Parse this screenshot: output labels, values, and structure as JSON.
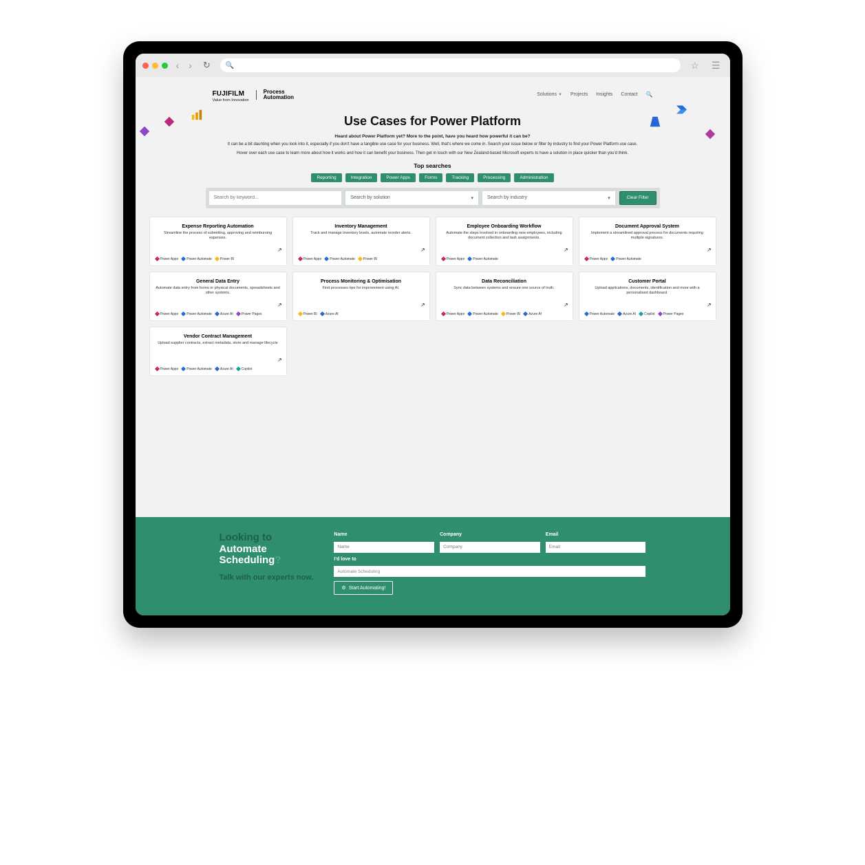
{
  "brand": {
    "main": "FUJIFILM",
    "tag": "Value from Innovation",
    "subbrand": "Process\nAutomation"
  },
  "nav": {
    "solutions": "Solutions",
    "projects": "Projects",
    "insights": "Insights",
    "contact": "Contact"
  },
  "hero": {
    "title": "Use Cases for Power Platform",
    "lead": "Heard about Power Platform yet? More to the point, have you heard how powerful it can be?",
    "p1": "It can be a bit daunting when you look into it, especially if you don't have a tangible use case for your business. Well, that's where we come in. Search your issue below or filter by industry to find your Power Platform use case.",
    "p2": "Hover over each use case to learn more about how it works and how it can benefit your business. Then get in touch with our New Zealand-based Microsoft experts to have a solution in place quicker than you'd think.",
    "topsearch": "Top searches"
  },
  "chips": [
    "Reporting",
    "Integration",
    "Power Apps",
    "Forms",
    "Tracking",
    "Processing",
    "Administration"
  ],
  "filter": {
    "keyword_ph": "Search by keyword...",
    "solution": "Search by solution",
    "industry": "Search by industry",
    "clear": "Clear Filter"
  },
  "tags": {
    "pa": "Power Apps",
    "au": "Power Automate",
    "bi": "Power BI",
    "az": "Azure AI",
    "co": "Copilot",
    "pp": "Power Pages"
  },
  "cards": [
    {
      "t": "Expense Reporting Automation",
      "d": "Streamline the process of submitting, approving and reimbursing expenses.",
      "tags": [
        "pa",
        "au",
        "bi"
      ]
    },
    {
      "t": "Inventory Management",
      "d": "Track and manage inventory levels, automate reorder alerts.",
      "tags": [
        "pa",
        "au",
        "bi"
      ]
    },
    {
      "t": "Employee Onboarding Workflow",
      "d": "Automate the steps involved in onboarding new employees, including document collection and task assignments.",
      "tags": [
        "pa",
        "au"
      ]
    },
    {
      "t": "Document Approval System",
      "d": "Implement a streamlined approval process for documents requiring multiple signatures.",
      "tags": [
        "pa",
        "au"
      ]
    },
    {
      "t": "General Data Entry",
      "d": "Automate data entry from forms or physical documents, spreadsheets and other systems.",
      "tags": [
        "pa",
        "au",
        "az",
        "pp"
      ]
    },
    {
      "t": "Process Monitoring & Optimisation",
      "d": "Find processes ripe for improvement using AI.",
      "tags": [
        "bi",
        "az"
      ]
    },
    {
      "t": "Data Reconciliation",
      "d": "Sync data between systems and ensure one source of truth.",
      "tags": [
        "pa",
        "au",
        "bi",
        "az"
      ]
    },
    {
      "t": "Customer Portal",
      "d": "Upload applications, documents, identification and more with a personalised dashboard.",
      "tags": [
        "au",
        "az",
        "co",
        "pp"
      ]
    },
    {
      "t": "Vendor Contract Management",
      "d": "Upload supplier contracts, extract metadata, store and manage lifecycle",
      "tags": [
        "pa",
        "au",
        "az",
        "co"
      ]
    }
  ],
  "cta": {
    "h_looking": "Looking to",
    "h_auto": "Automate",
    "h_sched": "Scheduling",
    "q": "?",
    "sub": "Talk with our experts now.",
    "name_l": "Name",
    "name_ph": "Name",
    "company_l": "Company",
    "company_ph": "Company",
    "email_l": "Email",
    "email_ph": "Email",
    "love_l": "I'd love to",
    "love_v": "Automate Scheduling",
    "btn": "Start Automating!"
  }
}
